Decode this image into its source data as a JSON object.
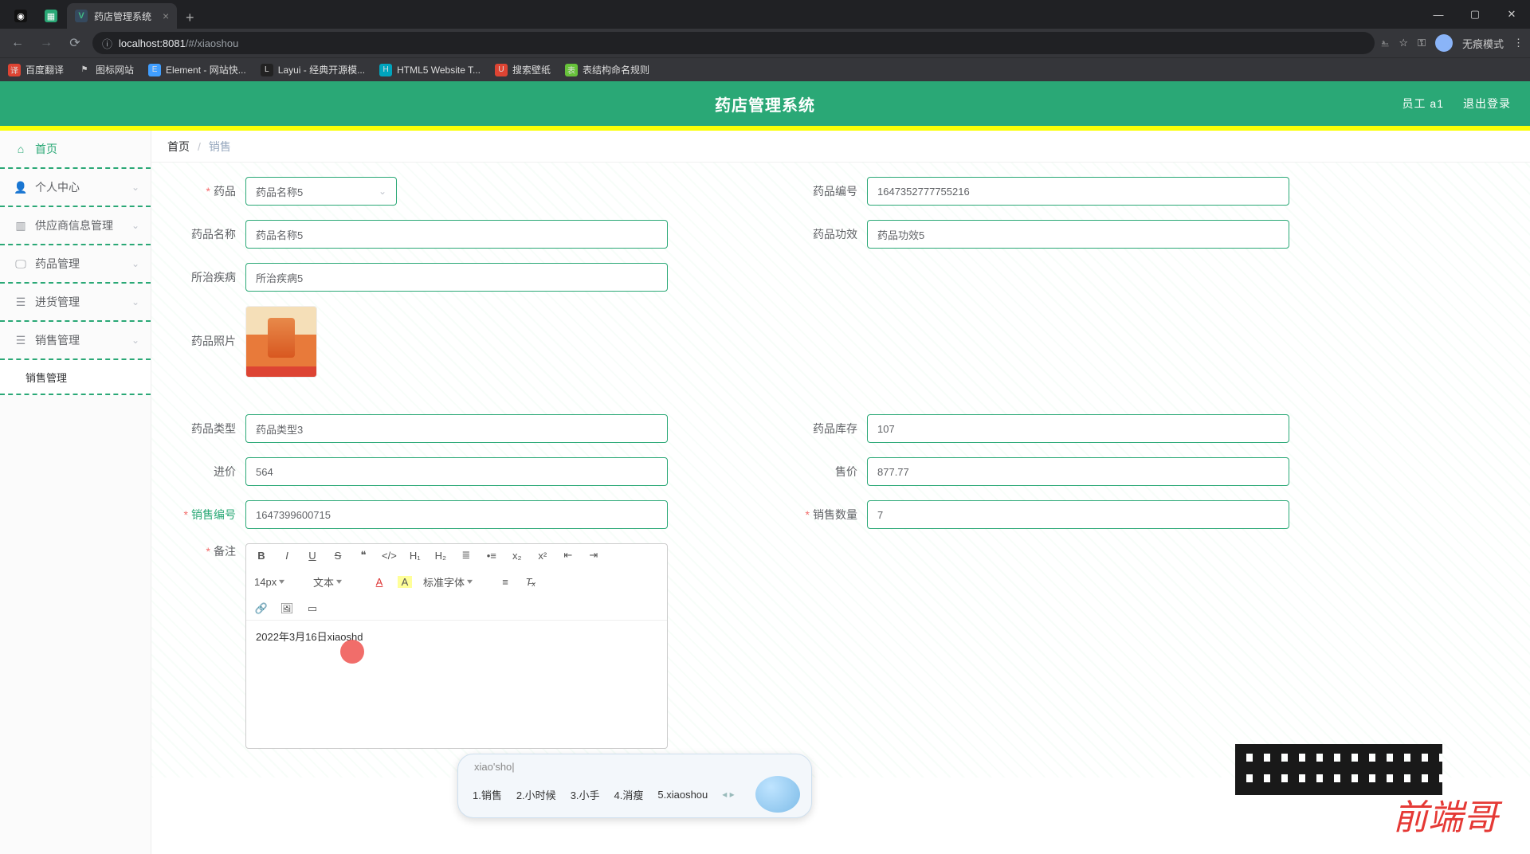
{
  "browser": {
    "tabs": [
      {
        "favicon": "dark",
        "label": ""
      },
      {
        "favicon": "green",
        "label": ""
      },
      {
        "favicon": "vue",
        "label": "药店管理系统",
        "active": true
      }
    ],
    "url_prefix": "localhost:8081",
    "url_path": "/#/xiaoshou",
    "incognito": "无痕模式",
    "bookmarks": [
      {
        "icon": "red",
        "label": "百度翻译"
      },
      {
        "icon": "flag",
        "label": "图标网站"
      },
      {
        "icon": "blue",
        "label": "Element - 网站快..."
      },
      {
        "icon": "dark",
        "label": "Layui - 经典开源模..."
      },
      {
        "icon": "cyan",
        "label": "HTML5 Website T..."
      },
      {
        "icon": "red",
        "label": "搜索壁纸"
      },
      {
        "icon": "green",
        "label": "表结构命名规则"
      }
    ]
  },
  "header": {
    "title": "药店管理系统",
    "user": "员工 a1",
    "logout": "退出登录"
  },
  "sidebar": {
    "items": [
      {
        "icon": "home",
        "label": "首页"
      },
      {
        "icon": "user",
        "label": "个人中心",
        "expandable": true
      },
      {
        "icon": "chart",
        "label": "供应商信息管理",
        "expandable": true
      },
      {
        "icon": "monitor",
        "label": "药品管理",
        "expandable": true
      },
      {
        "icon": "list",
        "label": "进货管理",
        "expandable": true
      },
      {
        "icon": "list",
        "label": "销售管理",
        "expandable": true
      }
    ],
    "active_sub": "销售管理"
  },
  "breadcrumb": {
    "root": "首页",
    "current": "销售"
  },
  "form": {
    "drug_label": "药品",
    "drug_value": "药品名称5",
    "drug_code_label": "药品编号",
    "drug_code_value": "1647352777755216",
    "drug_name_label": "药品名称",
    "drug_name_value": "药品名称5",
    "drug_effect_label": "药品功效",
    "drug_effect_value": "药品功效5",
    "disease_label": "所治疾病",
    "disease_value": "所治疾病5",
    "photo_label": "药品照片",
    "type_label": "药品类型",
    "type_value": "药品类型3",
    "stock_label": "药品库存",
    "stock_value": "107",
    "purchase_label": "进价",
    "purchase_value": "564",
    "sale_label": "售价",
    "sale_value": "877.77",
    "sale_no_label": "销售编号",
    "sale_no_value": "1647399600715",
    "sale_qty_label": "销售数量",
    "sale_qty_value": "7",
    "remark_label": "备注"
  },
  "editor": {
    "font_size": "14px",
    "block_type": "文本",
    "font_family": "标准字体",
    "content": "2022年3月16日xiaoshd"
  },
  "ime": {
    "input": "xiao'sho|",
    "candidates": [
      "1.销售",
      "2.小时候",
      "3.小手",
      "4.消瘦",
      "5.xiaoshou"
    ]
  },
  "watermark": "前端哥"
}
